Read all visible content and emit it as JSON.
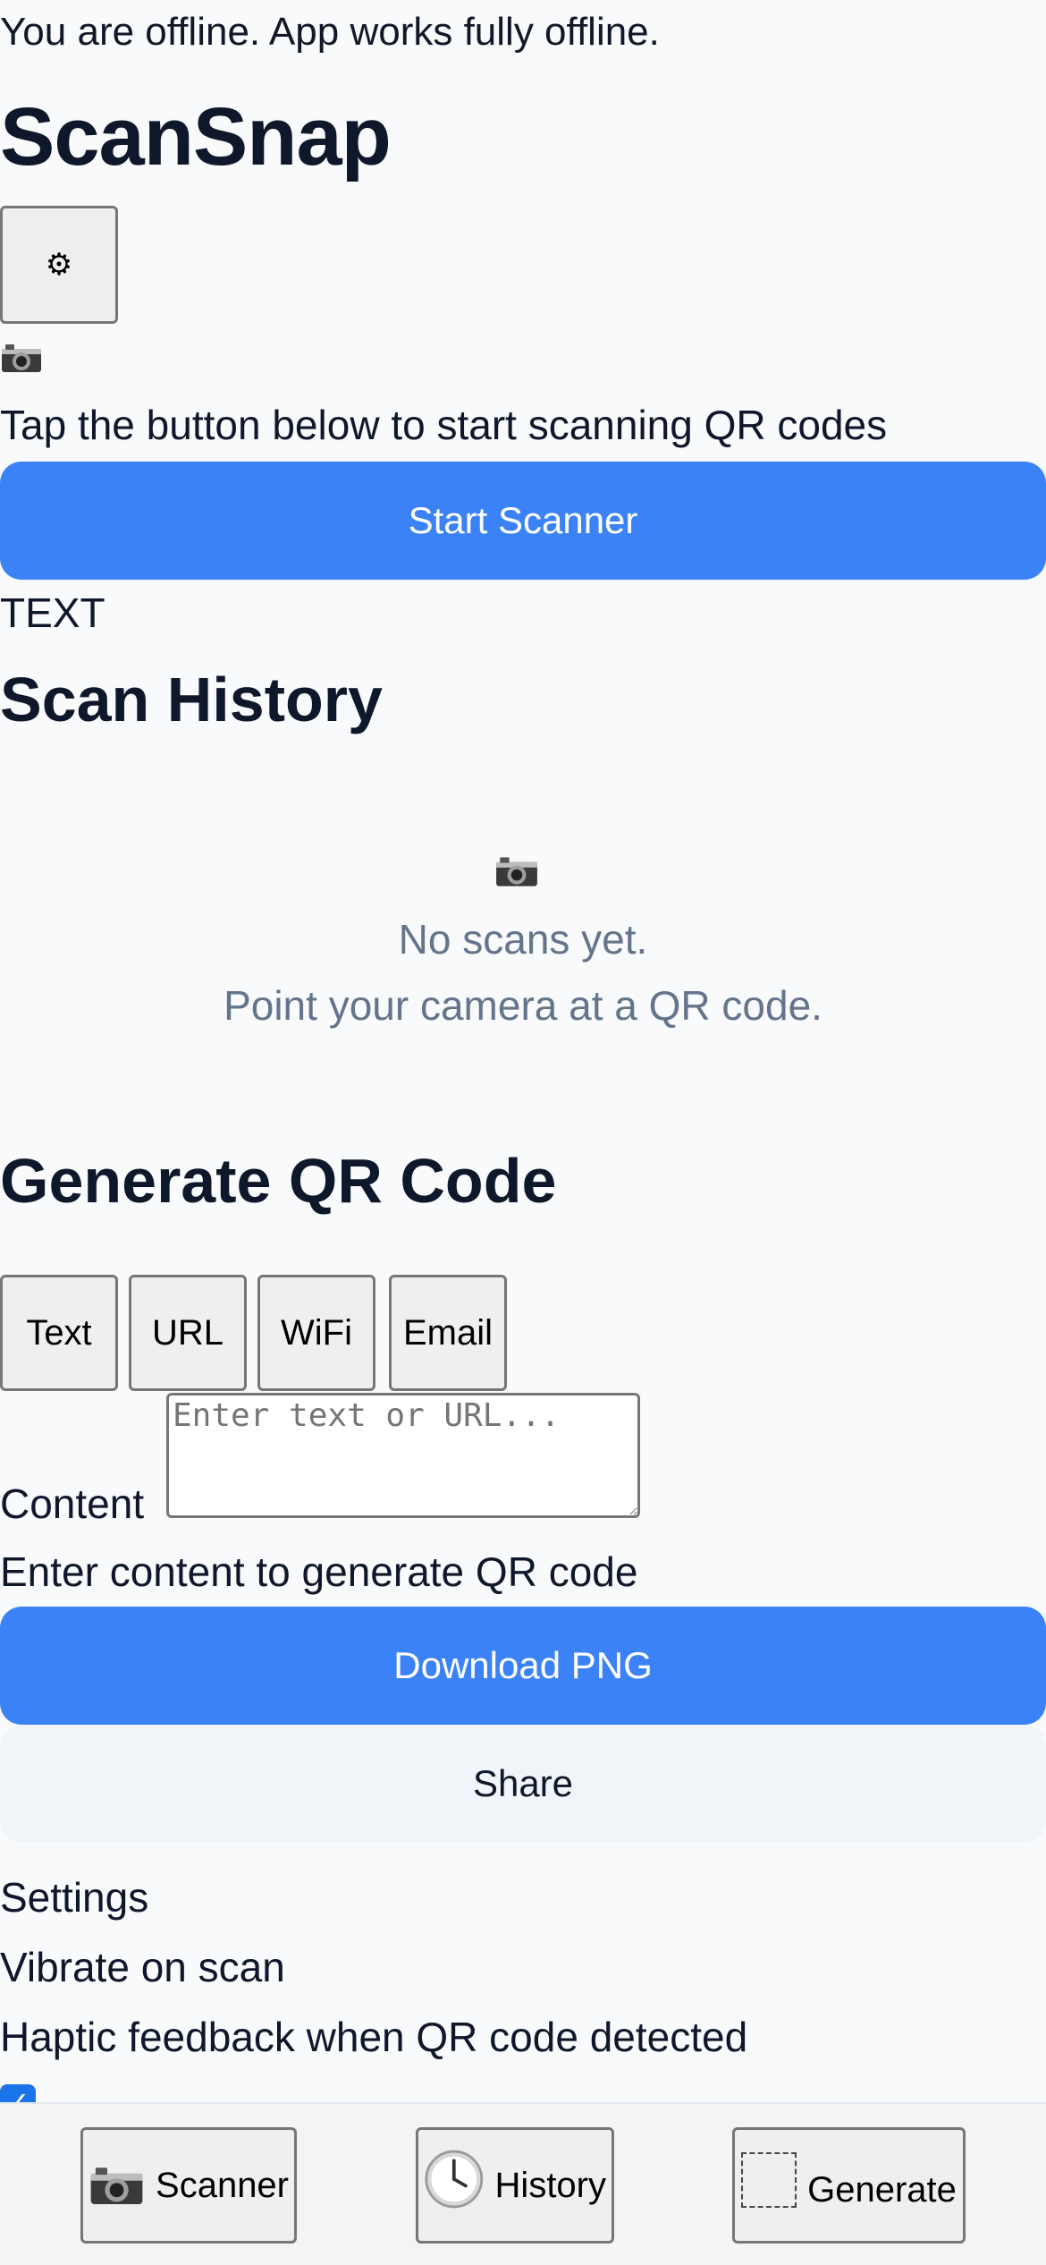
{
  "status": {
    "offline_text": "You are offline. App works fully offline."
  },
  "header": {
    "title": "ScanSnap",
    "settings_icon": "⚙"
  },
  "scanner": {
    "icon": "camera-icon",
    "hint": "Tap the button below to start scanning QR codes",
    "start_label": "Start Scanner",
    "mode_label": "TEXT"
  },
  "history": {
    "title": "Scan History",
    "empty_icon": "camera-icon",
    "empty_line1": "No scans yet.",
    "empty_line2": "Point your camera at a QR code."
  },
  "generate": {
    "title": "Generate QR Code",
    "types": [
      "Text",
      "URL",
      "WiFi",
      "Email"
    ],
    "content_label": "Content",
    "content_placeholder": "Enter text or URL...",
    "hint": "Enter content to generate QR code",
    "download_label": "Download PNG",
    "share_label": "Share"
  },
  "settings": {
    "label": "Settings",
    "vibrate_label": "Vibrate on scan",
    "vibrate_desc": "Haptic feedback when QR code detected",
    "vibrate_checked": true
  },
  "nav": {
    "items": [
      {
        "label": "Scanner",
        "icon": "camera-icon"
      },
      {
        "label": "History",
        "icon": "clock-icon"
      },
      {
        "label": "Generate",
        "icon": "dashed-square-icon"
      }
    ]
  },
  "colors": {
    "primary": "#3b82f6",
    "background": "#f8fafc",
    "muted_text": "#64748b"
  }
}
